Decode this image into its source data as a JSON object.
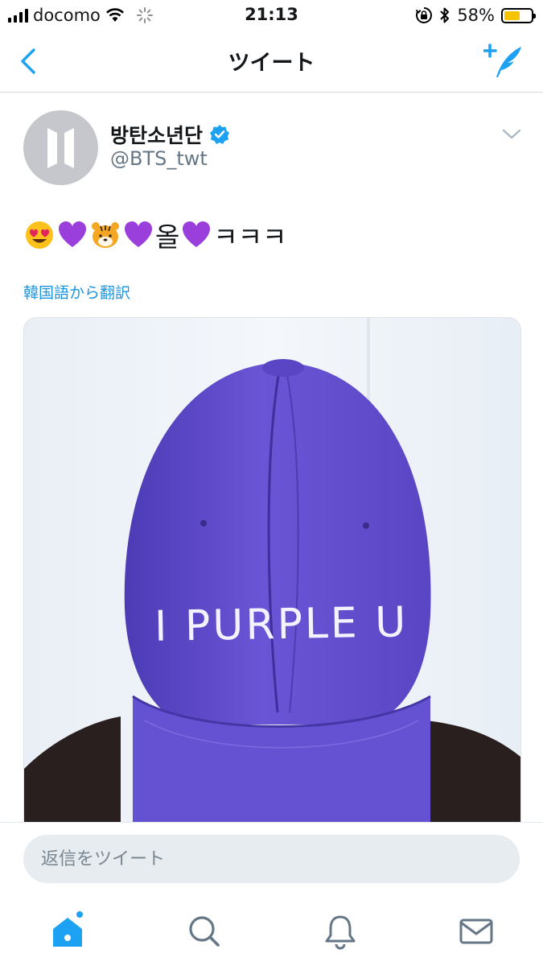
{
  "status_bar": {
    "carrier": "docomo",
    "time": "21:13",
    "battery_percent": "58%",
    "battery_level": 0.58,
    "icons": [
      "signal-icon",
      "wifi-icon",
      "activity-spinner-icon",
      "orientation-lock-icon",
      "bluetooth-icon",
      "battery-icon"
    ]
  },
  "nav": {
    "title": "ツイート",
    "back_icon": "chevron-left-icon",
    "compose_icon": "compose-tweet-icon"
  },
  "author": {
    "name": "방탄소년단",
    "handle": "@BTS_twt",
    "verified": true,
    "avatar_icon": "bts-logo"
  },
  "tweet": {
    "emoji_sequence": [
      "smiling-heart-eyes",
      "purple-heart",
      "tiger-face",
      "purple-heart"
    ],
    "text_mid": "올",
    "text_end": "ㅋㅋㅋ",
    "translate_link": "韓国語から翻訳"
  },
  "media": {
    "image_text": "I PURPLE U",
    "colors": {
      "cap": "#6a55d6",
      "background": "#eef3f8",
      "shirt": "#2a1f1f"
    }
  },
  "reply": {
    "placeholder": "返信をツイート"
  },
  "tab_bar": {
    "tabs": [
      "home-icon",
      "search-icon",
      "notifications-icon",
      "messages-icon"
    ],
    "active": "home-icon",
    "accent": "#1da1f2"
  }
}
